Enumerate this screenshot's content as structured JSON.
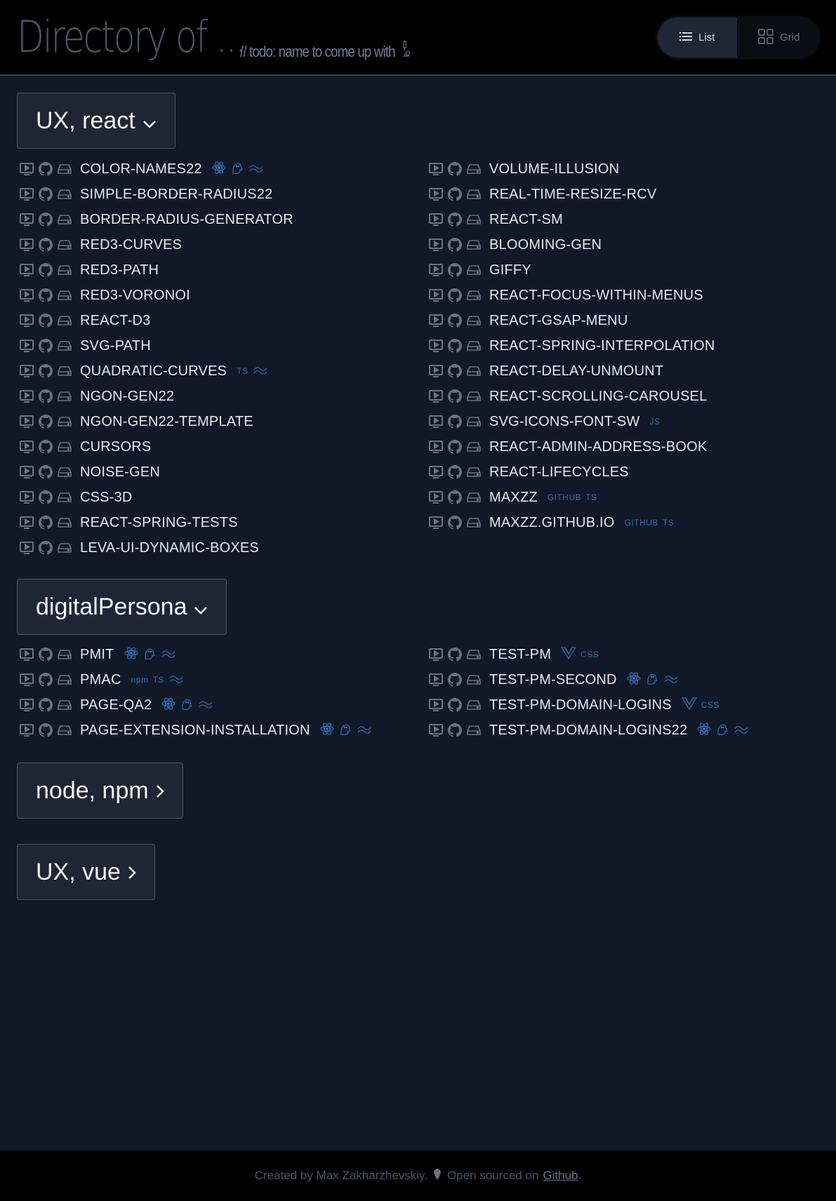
{
  "header": {
    "title": "Directory of ...",
    "subtitle": "// todo: name to come up with",
    "subtitle_icon": "microscope-icon",
    "view_toggle": [
      {
        "label": "List",
        "icon": "list-icon",
        "active": true
      },
      {
        "label": "Grid",
        "icon": "grid-icon",
        "active": false
      }
    ]
  },
  "sections": [
    {
      "label": "UX, react",
      "expanded": true,
      "columns": [
        [
          {
            "name": "COLOR-NAMES22",
            "tags": [
              {
                "icon": "react"
              },
              {
                "icon": "ghost"
              },
              {
                "icon": "tailwind"
              }
            ]
          },
          {
            "name": "SIMPLE-BORDER-RADIUS22",
            "tags": []
          },
          {
            "name": "BORDER-RADIUS-GENERATOR",
            "tags": []
          },
          {
            "name": "RED3-CURVES",
            "tags": []
          },
          {
            "name": "RED3-PATH",
            "tags": []
          },
          {
            "name": "RED3-VORONOI",
            "tags": []
          },
          {
            "name": "REACT-D3",
            "tags": []
          },
          {
            "name": "SVG-PATH",
            "tags": []
          },
          {
            "name": "QUADRATIC-CURVES",
            "tags": [
              {
                "text": "TS"
              },
              {
                "icon": "tailwind"
              }
            ]
          },
          {
            "name": "NGON-GEN22",
            "tags": []
          },
          {
            "name": "NGON-GEN22-TEMPLATE",
            "tags": []
          },
          {
            "name": "CURSORS",
            "tags": []
          },
          {
            "name": "NOISE-GEN",
            "tags": []
          },
          {
            "name": "CSS-3D",
            "tags": []
          },
          {
            "name": "REACT-SPRING-TESTS",
            "tags": []
          },
          {
            "name": "LEVA-UI-DYNAMIC-BOXES",
            "tags": []
          }
        ],
        [
          {
            "name": "VOLUME-ILLUSION",
            "tags": []
          },
          {
            "name": "REAL-TIME-RESIZE-RCV",
            "tags": []
          },
          {
            "name": "REACT-SM",
            "tags": []
          },
          {
            "name": "BLOOMING-GEN",
            "tags": []
          },
          {
            "name": "GIFFY",
            "tags": []
          },
          {
            "name": "REACT-FOCUS-WITHIN-MENUS",
            "tags": []
          },
          {
            "name": "REACT-GSAP-MENU",
            "tags": []
          },
          {
            "name": "REACT-SPRING-INTERPOLATION",
            "tags": []
          },
          {
            "name": "REACT-DELAY-UNMOUNT",
            "tags": []
          },
          {
            "name": "REACT-SCROLLING-CAROUSEL",
            "tags": []
          },
          {
            "name": "SVG-ICONS-FONT-SW",
            "tags": [
              {
                "text": "JS"
              }
            ]
          },
          {
            "name": "REACT-ADMIN-ADDRESS-BOOK",
            "tags": []
          },
          {
            "name": "REACT-LIFECYCLES",
            "tags": []
          },
          {
            "name": "MAXZZ",
            "tags": [
              {
                "text": "GITHUB"
              },
              {
                "text": "TS"
              }
            ]
          },
          {
            "name": "MAXZZ.GITHUB.IO",
            "tags": [
              {
                "text": "GITHUB"
              },
              {
                "text": "TS"
              }
            ]
          }
        ]
      ]
    },
    {
      "label": "digitalPersona",
      "expanded": true,
      "columns": [
        [
          {
            "name": "PMIT",
            "tags": [
              {
                "icon": "react"
              },
              {
                "icon": "ghost"
              },
              {
                "icon": "tailwind"
              }
            ]
          },
          {
            "name": "PMAC",
            "tags": [
              {
                "text": "npm"
              },
              {
                "text": "TS"
              },
              {
                "icon": "tailwind"
              }
            ]
          },
          {
            "name": "PAGE-QA2",
            "tags": [
              {
                "icon": "react"
              },
              {
                "icon": "ghost"
              },
              {
                "icon": "tailwind"
              }
            ]
          },
          {
            "name": "PAGE-EXTENSION-INSTALLATION",
            "tags": [
              {
                "icon": "react"
              },
              {
                "icon": "ghost"
              },
              {
                "icon": "tailwind"
              }
            ]
          }
        ],
        [
          {
            "name": "TEST-PM",
            "tags": [
              {
                "icon": "vue"
              },
              {
                "text": "CSS"
              }
            ]
          },
          {
            "name": "TEST-PM-SECOND",
            "tags": [
              {
                "icon": "react"
              },
              {
                "icon": "ghost"
              },
              {
                "icon": "tailwind"
              }
            ]
          },
          {
            "name": "TEST-PM-DOMAIN-LOGINS",
            "tags": [
              {
                "icon": "vue"
              },
              {
                "text": "CSS"
              }
            ]
          },
          {
            "name": "TEST-PM-DOMAIN-LOGINS22",
            "tags": [
              {
                "icon": "react"
              },
              {
                "icon": "ghost"
              },
              {
                "icon": "tailwind"
              }
            ]
          }
        ]
      ]
    },
    {
      "label": "node, npm",
      "expanded": false
    },
    {
      "label": "UX, vue",
      "expanded": false
    }
  ],
  "footer": {
    "text1": "Created by Max Zakharzhevskiy.",
    "text2": "Open sourced on",
    "link": "Github",
    "period": "."
  },
  "colors": {
    "background": "#111827",
    "header": "#000000",
    "tag": "#2f6db1"
  }
}
